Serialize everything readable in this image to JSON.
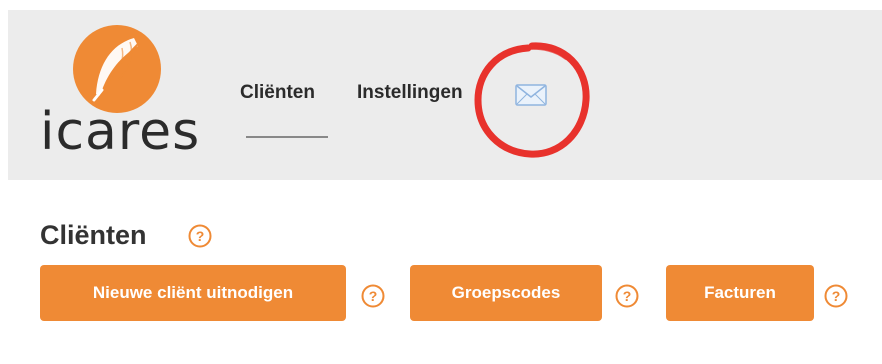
{
  "brand": {
    "name": "icares",
    "accent_color": "#ef8a35",
    "logo_icon": "feather-icon"
  },
  "nav": {
    "items": [
      {
        "label": "Cliënten",
        "active": true
      },
      {
        "label": "Instellingen",
        "active": false
      }
    ],
    "mail_icon": "envelope-icon"
  },
  "main": {
    "title": "Cliënten",
    "buttons": [
      {
        "label": "Nieuwe cliënt uitnodigen",
        "icon": "help-icon"
      },
      {
        "label": "Groepscodes",
        "icon": "help-icon"
      },
      {
        "label": "Facturen",
        "icon": "help-icon"
      }
    ]
  }
}
